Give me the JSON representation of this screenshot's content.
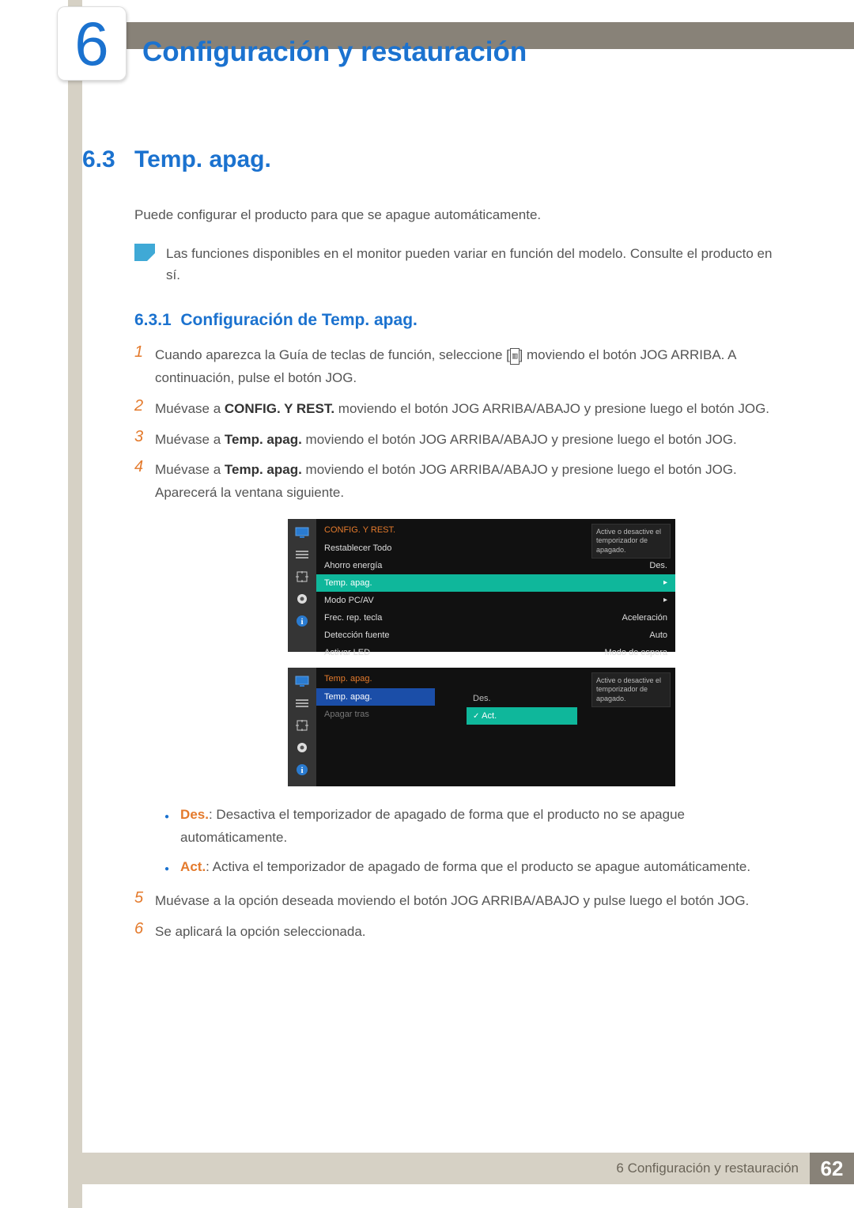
{
  "chapter": {
    "number": "6",
    "title": "Configuración y restauración"
  },
  "section": {
    "number": "6.3",
    "title": "Temp. apag."
  },
  "intro": "Puede configurar el producto para que se apague automáticamente.",
  "note": "Las funciones disponibles en el monitor pueden variar en función del modelo. Consulte el producto en sí.",
  "subsection": {
    "number": "6.3.1",
    "title": "Configuración de Temp. apag."
  },
  "steps": {
    "s1a": "Cuando aparezca la Guía de teclas de función, seleccione [",
    "s1b": "] moviendo el botón JOG ARRIBA. A continuación, pulse el botón JOG.",
    "s2a": "Muévase a ",
    "s2bold": "CONFIG. Y REST.",
    "s2b": " moviendo el botón JOG ARRIBA/ABAJO y presione luego el botón JOG.",
    "s3a": "Muévase a ",
    "s3bold": "Temp. apag.",
    "s3b": " moviendo el botón JOG ARRIBA/ABAJO y presione luego el botón JOG.",
    "s4a": "Muévase a ",
    "s4bold": "Temp. apag.",
    "s4b": " moviendo el botón JOG ARRIBA/ABAJO y presione luego el botón JOG.",
    "s4c": "Aparecerá la ventana siguiente.",
    "s5": "Muévase a la opción deseada moviendo el botón JOG ARRIBA/ABAJO y pulse luego el botón JOG.",
    "s6": "Se aplicará la opción seleccionada."
  },
  "bullets": {
    "des_label": "Des.",
    "des_text": ": Desactiva el temporizador de apagado de forma que el producto no se apague automáticamente.",
    "act_label": "Act.",
    "act_text": ": Activa el temporizador de apagado de forma que el producto se apague automáticamente."
  },
  "osd1": {
    "header": "CONFIG. Y REST.",
    "tooltip": "Active o desactive el temporizador de apagado.",
    "rows": [
      {
        "label": "Restablecer Todo",
        "value": ""
      },
      {
        "label": "Ahorro energía",
        "value": "Des."
      },
      {
        "label": "Temp. apag.",
        "value": "▸",
        "hl": true
      },
      {
        "label": "Modo PC/AV",
        "value": "▸"
      },
      {
        "label": "Frec. rep. tecla",
        "value": "Aceleración"
      },
      {
        "label": "Detección fuente",
        "value": "Auto"
      },
      {
        "label": "Activar LED",
        "value": "Modo de espera"
      }
    ]
  },
  "osd2": {
    "header": "Temp. apag.",
    "tooltip": "Active o desactive el temporizador de apagado.",
    "rows": [
      {
        "label": "Temp. apag.",
        "value": "",
        "hl_blue": true
      },
      {
        "label": "Apagar tras",
        "value": "",
        "dim": true
      }
    ],
    "options": [
      {
        "label": "Des.",
        "sel": false
      },
      {
        "label": "Act.",
        "sel": true
      }
    ]
  },
  "footer": {
    "text": "6 Configuración y restauración",
    "page": "62"
  }
}
